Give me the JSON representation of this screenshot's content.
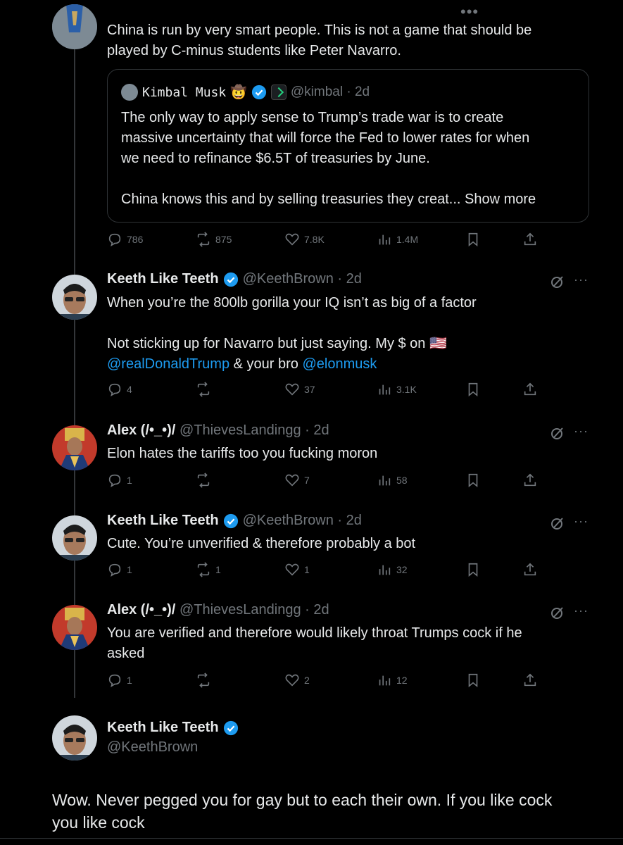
{
  "top_tweet": {
    "text": "China is run by very smart people. This is not a game that should be\nplayed by C-minus students like Peter Navarro.",
    "quote": {
      "name": "Kimbal Musk",
      "emoji": "🤠",
      "handle": "@kimbal",
      "time": "2d",
      "text": "The only way to apply sense to Trump’s trade war is to create\nmassive uncertainty that will force the Fed to lower rates for when\nwe need to refinance $6.5T of treasuries by June.\n\nChina knows this and by selling treasuries they creat...",
      "show_more": "Show more"
    },
    "stats": {
      "replies": "786",
      "reposts": "875",
      "likes": "7.8K",
      "views": "1.4M"
    }
  },
  "replies": [
    {
      "name": "Keeth Like Teeth",
      "handle": "@KeethBrown",
      "time": "2d",
      "verified": true,
      "text_line1": "When you’re the 800lb gorilla your IQ isn’t as big of a factor",
      "text_line2": "Not sticking up for Navarro but just saying. My $ on",
      "flag": "🇺🇸",
      "mention1": "@realDonaldTrump",
      "mid_text": " & your bro ",
      "mention2": "@elonmusk",
      "stats": {
        "replies": "4",
        "reposts": "",
        "likes": "37",
        "views": "3.1K"
      }
    },
    {
      "name": "Alex (/•_•)/",
      "handle": "@ThievesLandingg",
      "time": "2d",
      "verified": false,
      "text": "Elon hates the tariffs too you fucking moron",
      "stats": {
        "replies": "1",
        "reposts": "",
        "likes": "7",
        "views": "58"
      }
    },
    {
      "name": "Keeth Like Teeth",
      "handle": "@KeethBrown",
      "time": "2d",
      "verified": true,
      "text": "Cute. You’re unverified & therefore probably a bot",
      "stats": {
        "replies": "1",
        "reposts": "1",
        "likes": "1",
        "views": "32"
      }
    },
    {
      "name": "Alex (/•_•)/",
      "handle": "@ThievesLandingg",
      "time": "2d",
      "verified": false,
      "text": "You are verified and therefore would likely throat Trumps cock if he\nasked",
      "stats": {
        "replies": "1",
        "reposts": "",
        "likes": "2",
        "views": "12"
      }
    }
  ],
  "main_tweet": {
    "name": "Keeth Like Teeth",
    "handle": "@KeethBrown",
    "text": "Wow. Never pegged you for gay but to each their own. If you like cock\nyou like cock"
  },
  "colors": {
    "background": "#000000",
    "text": "#e7e9ea",
    "muted": "#71767b",
    "accent": "#1d9bf0"
  }
}
